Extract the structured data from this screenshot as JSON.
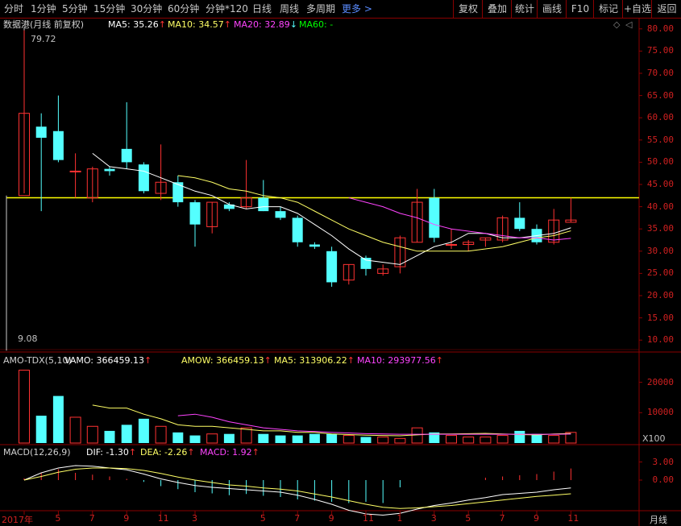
{
  "periods": [
    "分时",
    "1分钟",
    "5分钟",
    "15分钟",
    "30分钟",
    "60分钟",
    "分钟*120",
    "日线",
    "周线",
    "多周期"
  ],
  "more_label": "更多",
  "toolbar": [
    "复权",
    "叠加",
    "统计",
    "画线",
    "F10",
    "标记",
    "+自选",
    "返回"
  ],
  "main": {
    "title": "数据港(月线 前复权)",
    "ma5": "MA5: 35.26",
    "ma10": "MA10: 34.57",
    "ma20": "MA20: 32.89",
    "ma60": "MA60: -",
    "high_label": "79.72",
    "low_label": "9.08",
    "yticks": [
      "80.00",
      "75.00",
      "70.00",
      "65.00",
      "60.00",
      "55.00",
      "50.00",
      "45.00",
      "40.00",
      "35.00",
      "30.00",
      "25.00",
      "20.00",
      "15.00",
      "10.00"
    ]
  },
  "vol": {
    "title": "AMO-TDX(5,10)",
    "vamo": "VAMO: 366459.13",
    "amow": "AMOW: 366459.13",
    "ma5": "MA5: 313906.22",
    "ma10": "MA10: 293977.56",
    "yticks": [
      "20000",
      "10000"
    ],
    "unit": "X100"
  },
  "macd": {
    "title": "MACD(12,26,9)",
    "dif": "DIF: -1.30",
    "dea": "DEA: -2.26",
    "macd": "MACD: 1.92",
    "yticks": [
      "3.00",
      "0.00"
    ]
  },
  "xaxis": {
    "labels": [
      "2017年",
      "5",
      "7",
      "9",
      "11",
      "3",
      "5",
      "7",
      "9",
      "11",
      "1",
      "3",
      "5",
      "7",
      "9",
      "11"
    ],
    "period_label": "月线"
  },
  "colors": {
    "up": "#ff3232",
    "down": "#54ffff",
    "ma5": "#ffffff",
    "ma10": "#ffff66",
    "ma20": "#ff44ff",
    "ma60": "#00ff00",
    "bg": "#000000",
    "grid": "#8a0000"
  },
  "chart_data": {
    "type": "candlestick",
    "candles": [
      {
        "o": 42.5,
        "h": 79.7,
        "l": 43,
        "c": 61
      },
      {
        "o": 58,
        "h": 61,
        "l": 39,
        "c": 55.5
      },
      {
        "o": 57,
        "h": 65,
        "l": 50,
        "c": 50.5
      },
      {
        "o": 48,
        "h": 52,
        "l": 42,
        "c": 48
      },
      {
        "o": 42,
        "h": 49,
        "l": 41,
        "c": 48.5
      },
      {
        "o": 48.5,
        "h": 49,
        "l": 47,
        "c": 48
      },
      {
        "o": 53,
        "h": 63.5,
        "l": 48.5,
        "c": 50
      },
      {
        "o": 49.5,
        "h": 50,
        "l": 43,
        "c": 43.5
      },
      {
        "o": 43,
        "h": 54,
        "l": 41.5,
        "c": 45.5
      },
      {
        "o": 45.5,
        "h": 47,
        "l": 40,
        "c": 41
      },
      {
        "o": 41,
        "h": 41.5,
        "l": 31,
        "c": 36
      },
      {
        "o": 35.5,
        "h": 41,
        "l": 34,
        "c": 41
      },
      {
        "o": 40.5,
        "h": 41,
        "l": 39,
        "c": 39.5
      },
      {
        "o": 40,
        "h": 50.5,
        "l": 39.5,
        "c": 42
      },
      {
        "o": 42,
        "h": 46,
        "l": 39,
        "c": 39
      },
      {
        "o": 39,
        "h": 40,
        "l": 37,
        "c": 37.5
      },
      {
        "o": 37.5,
        "h": 38,
        "l": 31,
        "c": 32
      },
      {
        "o": 31.5,
        "h": 32,
        "l": 30.5,
        "c": 31
      },
      {
        "o": 30,
        "h": 31,
        "l": 22,
        "c": 23
      },
      {
        "o": 23.5,
        "h": 27,
        "l": 22.5,
        "c": 27
      },
      {
        "o": 28.5,
        "h": 29,
        "l": 24.5,
        "c": 26
      },
      {
        "o": 25,
        "h": 27,
        "l": 24.5,
        "c": 26
      },
      {
        "o": 26.5,
        "h": 33.5,
        "l": 25,
        "c": 33
      },
      {
        "o": 32,
        "h": 44,
        "l": 32,
        "c": 41
      },
      {
        "o": 42,
        "h": 44,
        "l": 32,
        "c": 33
      },
      {
        "o": 31.5,
        "h": 35,
        "l": 30.5,
        "c": 31.5
      },
      {
        "o": 31.5,
        "h": 32.5,
        "l": 30,
        "c": 32
      },
      {
        "o": 32.5,
        "h": 33,
        "l": 31,
        "c": 33
      },
      {
        "o": 32.5,
        "h": 38,
        "l": 32,
        "c": 37.5
      },
      {
        "o": 37.5,
        "h": 41,
        "l": 34.5,
        "c": 35
      },
      {
        "o": 35,
        "h": 36,
        "l": 31.5,
        "c": 32
      },
      {
        "o": 32,
        "h": 39.5,
        "l": 31.5,
        "c": 37
      },
      {
        "o": 36.5,
        "h": 42,
        "l": 36.5,
        "c": 37
      }
    ],
    "ma5": [
      null,
      null,
      null,
      null,
      52,
      49,
      48.5,
      48,
      46.5,
      45,
      43.5,
      42.5,
      40.5,
      39.5,
      40,
      40,
      38.5,
      36,
      33.5,
      30.5,
      28,
      27.5,
      27,
      29,
      31,
      32,
      34,
      34,
      33,
      33,
      33.5,
      34,
      35.26
    ],
    "ma10": [
      null,
      null,
      null,
      null,
      null,
      null,
      null,
      null,
      null,
      47,
      46.5,
      45.5,
      44,
      43.5,
      42.5,
      42,
      41,
      39,
      37,
      35,
      33.5,
      32,
      31,
      30,
      30,
      30,
      30,
      30.5,
      31,
      32,
      33,
      33.5,
      34.57
    ],
    "ma20": [
      null,
      null,
      null,
      null,
      null,
      null,
      null,
      null,
      null,
      null,
      null,
      null,
      null,
      null,
      null,
      null,
      null,
      null,
      null,
      42,
      41,
      40,
      38.5,
      37.5,
      36,
      35,
      34.5,
      34,
      33.5,
      33,
      33,
      32.5,
      32.89
    ],
    "ref_line": 42,
    "volume": [
      24,
      9,
      15.5,
      8.5,
      5.5,
      4,
      6,
      8,
      5.5,
      3.5,
      2.5,
      3,
      3,
      5,
      3,
      2.5,
      2.5,
      3,
      3,
      2.5,
      2,
      2,
      1.5,
      5,
      3.5,
      2.5,
      2,
      2,
      2.5,
      4,
      3,
      2.5,
      3.5
    ],
    "vol_ma5": [
      null,
      null,
      null,
      null,
      12.5,
      11.5,
      11.5,
      9.5,
      8,
      6,
      5.5,
      5.5,
      5,
      4.5,
      4,
      4,
      3.5,
      3.5,
      3,
      2.8,
      2.6,
      2.5,
      2.4,
      2.7,
      3,
      3,
      3.1,
      3.2,
      3,
      2.8,
      2.7,
      3,
      3.14
    ],
    "vol_ma10": [
      null,
      null,
      null,
      null,
      null,
      null,
      null,
      null,
      null,
      9,
      9.5,
      8.5,
      7,
      6,
      5,
      4.5,
      4,
      3.8,
      3.5,
      3.3,
      3.1,
      3,
      2.9,
      2.9,
      2.9,
      2.9,
      2.9,
      2.9,
      2.9,
      2.9,
      2.9,
      2.9,
      2.94
    ],
    "macd_bars": [
      0.3,
      1.2,
      1.8,
      1.2,
      0.9,
      0.6,
      0.2,
      -0.3,
      -1.0,
      -1.5,
      -2.0,
      -2.2,
      -2.5,
      -2.3,
      -2.6,
      -2.8,
      -3.2,
      -3.4,
      -3.6,
      -3.8,
      -3.6,
      -3.8,
      -1.2,
      0,
      0,
      0,
      0,
      0.4,
      0.6,
      0.8,
      1.0,
      1.4,
      1.92
    ],
    "dif": [
      0,
      1.2,
      2.0,
      2.4,
      2.3,
      2.0,
      1.7,
      1.0,
      0.2,
      -0.4,
      -0.9,
      -1.2,
      -1.4,
      -1.6,
      -1.8,
      -2.0,
      -2.5,
      -3.2,
      -4.0,
      -5.0,
      -5.6,
      -5.8,
      -5.5,
      -4.8,
      -4.2,
      -3.8,
      -3.3,
      -2.9,
      -2.4,
      -2.2,
      -2.0,
      -1.6,
      -1.3
    ],
    "dea": [
      0,
      0.6,
      1.3,
      1.8,
      2.0,
      2.0,
      1.9,
      1.6,
      1.1,
      0.5,
      0.0,
      -0.4,
      -0.8,
      -1.0,
      -1.3,
      -1.5,
      -1.8,
      -2.3,
      -2.8,
      -3.4,
      -4.0,
      -4.5,
      -4.7,
      -4.6,
      -4.4,
      -4.2,
      -3.9,
      -3.6,
      -3.3,
      -3.0,
      -2.7,
      -2.5,
      -2.26
    ]
  }
}
